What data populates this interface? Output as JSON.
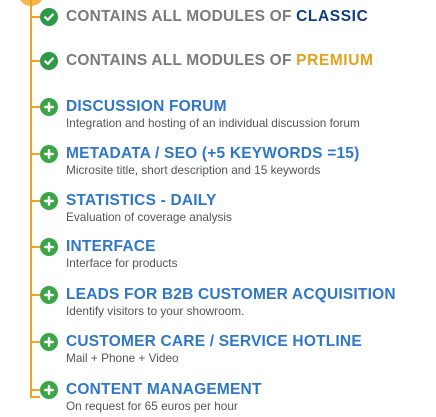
{
  "colors": {
    "accent": "#f0a126",
    "check_green": "#2e9a48",
    "plus_green": "#3aa648",
    "title_blue": "#2f78c8",
    "title_gray": "#7b7b7b",
    "classic_brand": "#0d3e83",
    "premium_brand": "#e3a11d"
  },
  "features": [
    {
      "icon": "check-circle-icon",
      "prefix": "CONTAINS ALL MODULES OF ",
      "brand": "CLASSIC"
    },
    {
      "icon": "check-circle-icon",
      "prefix": "CONTAINS ALL MODULES OF ",
      "brand": "PREMIUM"
    },
    {
      "icon": "plus-circle-icon",
      "title": "DISCUSSION FORUM",
      "description": "Integration and hosting of an individual discussion forum"
    },
    {
      "icon": "plus-circle-icon",
      "title": "METADATA / SEO (+5 KEYWORDS =15)",
      "description": "Microsite title, short description and 15 keywords"
    },
    {
      "icon": "plus-circle-icon",
      "title": "STATISTICS - DAILY",
      "description": "Evaluation of coverage analysis"
    },
    {
      "icon": "plus-circle-icon",
      "title": "INTERFACE",
      "description": "Interface for products"
    },
    {
      "icon": "plus-circle-icon",
      "title": "LEADS FOR B2B CUSTOMER ACQUISITION",
      "description": "Identify visitors to your showroom."
    },
    {
      "icon": "plus-circle-icon",
      "title": "CUSTOMER CARE / SERVICE HOTLINE",
      "description": "Mail + Phone + Video"
    },
    {
      "icon": "plus-circle-icon",
      "title": "CONTENT MANAGEMENT",
      "description": "On request for 65 euros per hour"
    }
  ]
}
